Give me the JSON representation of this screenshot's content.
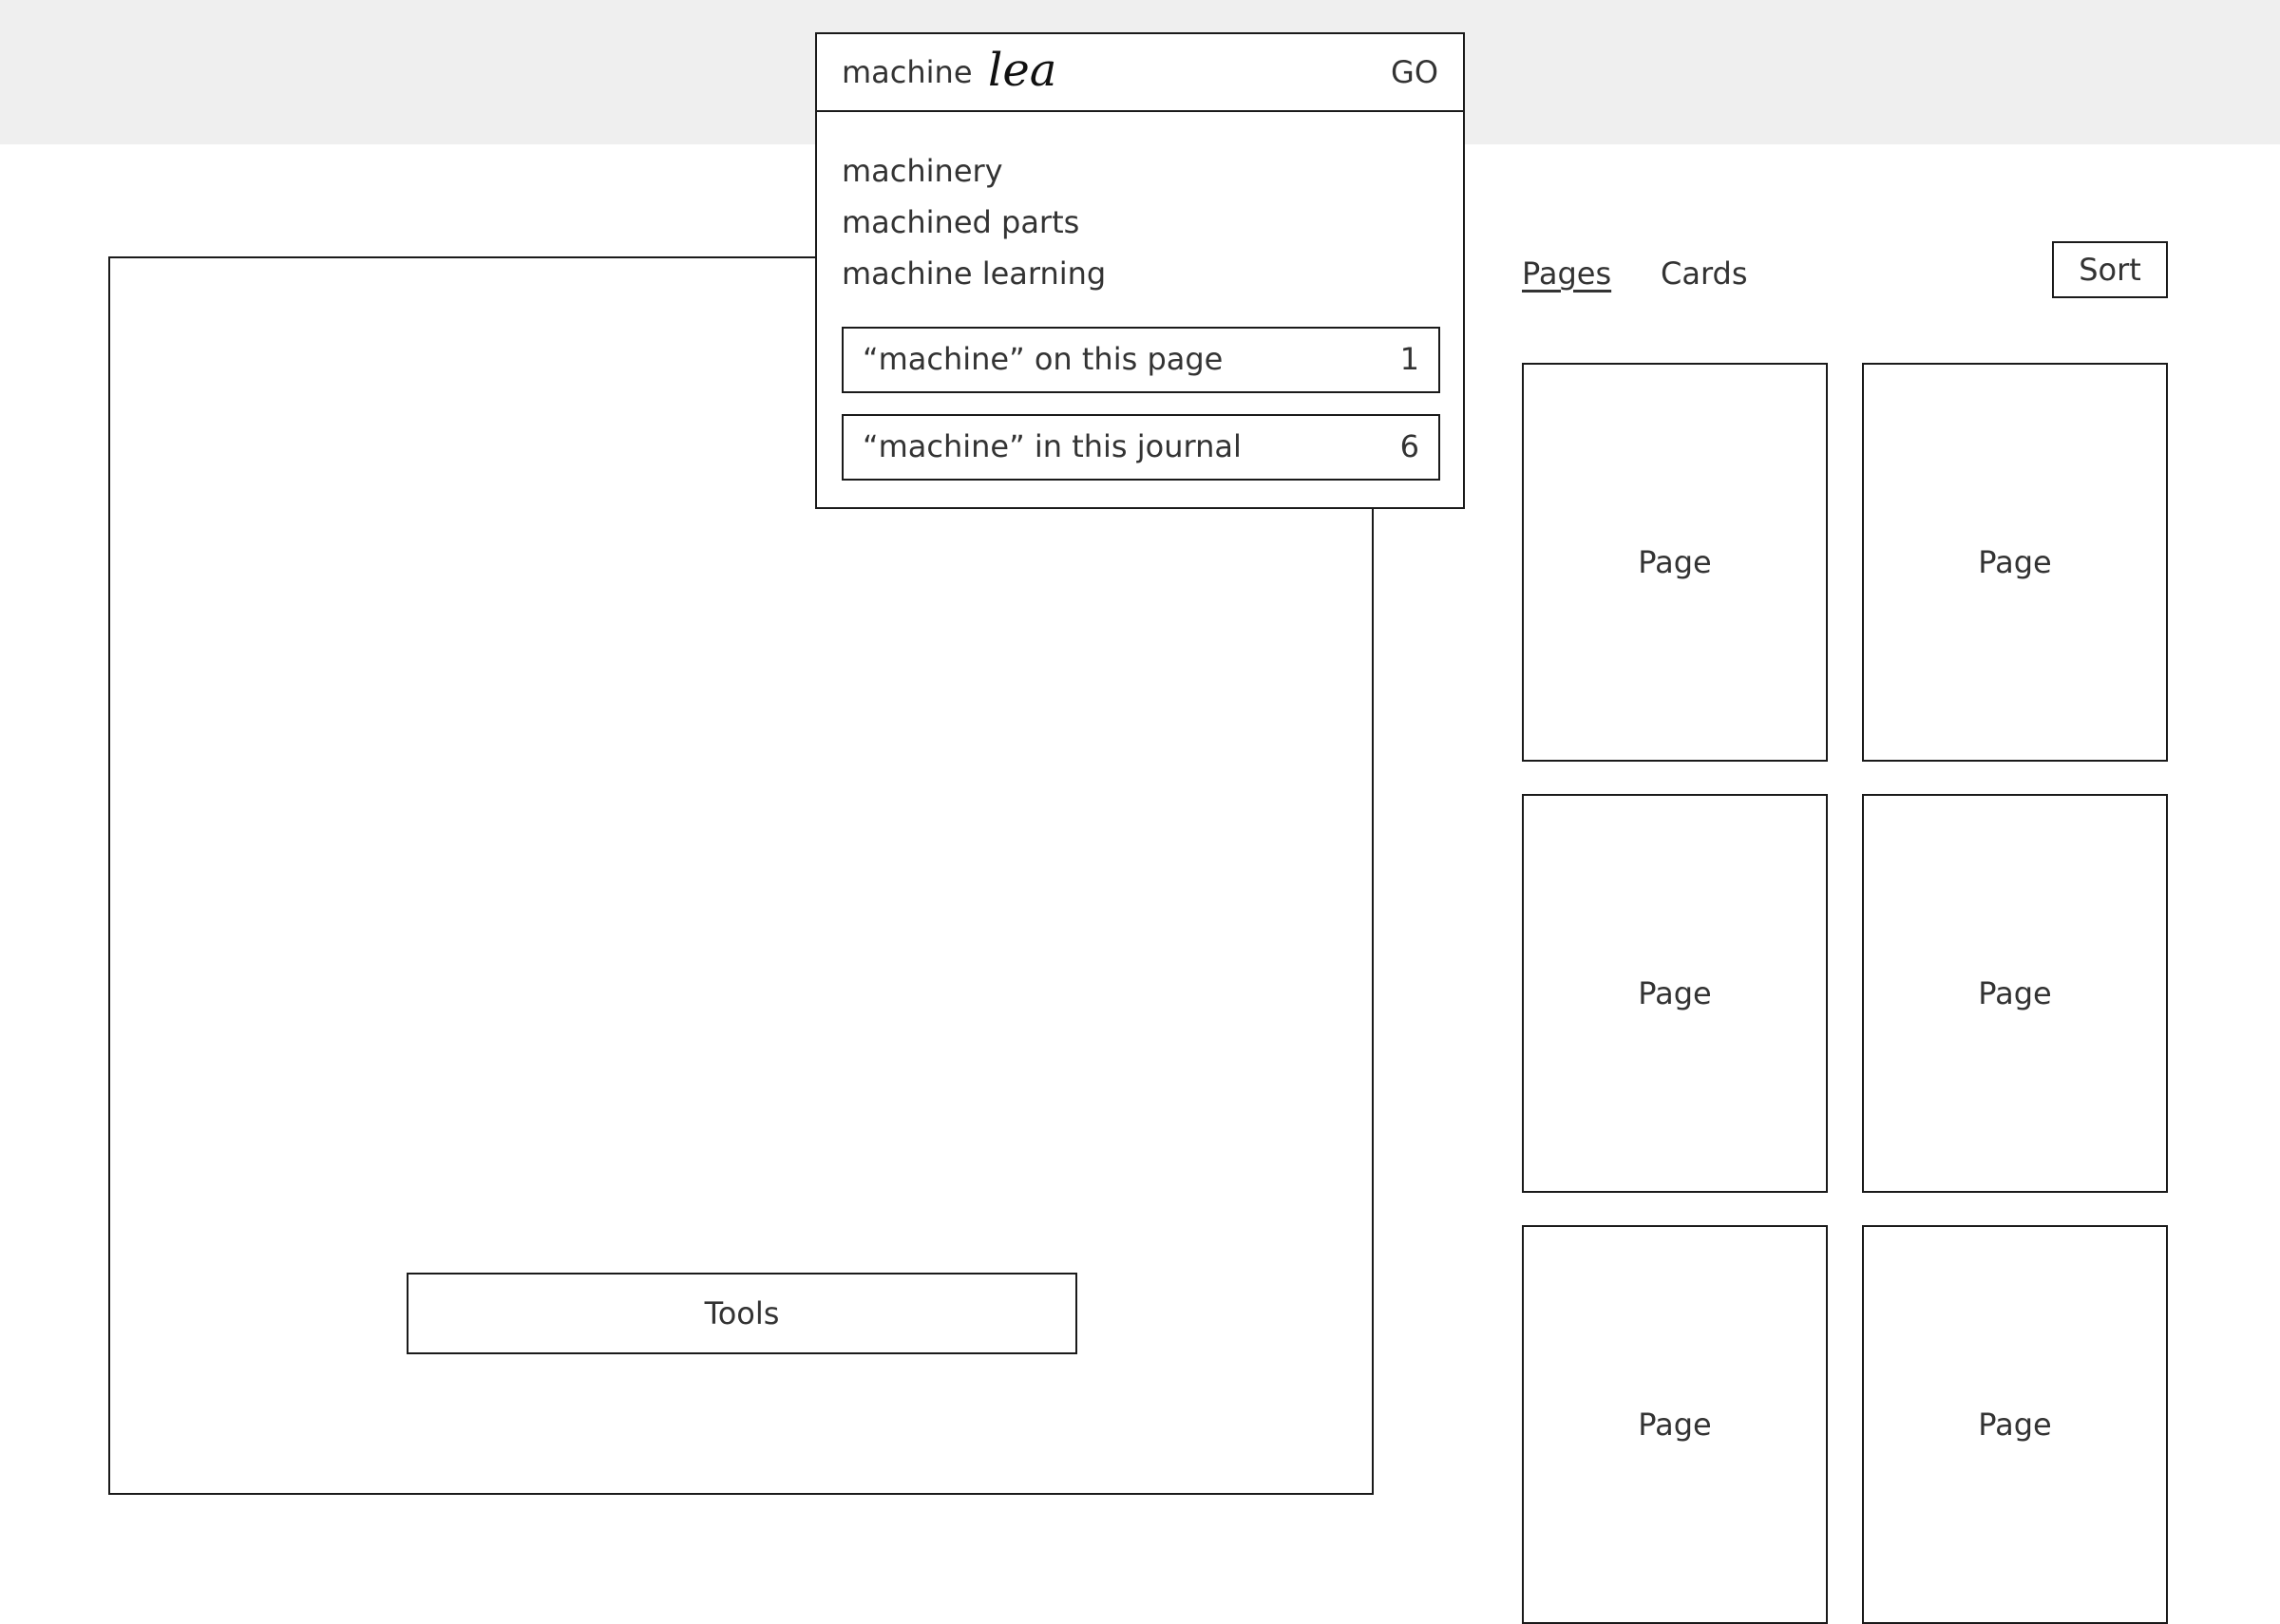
{
  "search": {
    "typed_text": "machine",
    "handwritten_text": "lea",
    "go_label": "GO",
    "suggestions": [
      "machinery",
      "machined parts",
      "machine learning"
    ],
    "results": [
      {
        "label": "“machine” on this page",
        "count": "1"
      },
      {
        "label": "“machine” in this journal",
        "count": "6"
      }
    ]
  },
  "canvas": {
    "tools_label": "Tools"
  },
  "sidebar": {
    "tabs": [
      {
        "label": "Pages",
        "active": true
      },
      {
        "label": "Cards",
        "active": false
      }
    ],
    "sort_label": "Sort",
    "thumbnails": [
      "Page",
      "Page",
      "Page",
      "Page",
      "Page",
      "Page"
    ]
  }
}
